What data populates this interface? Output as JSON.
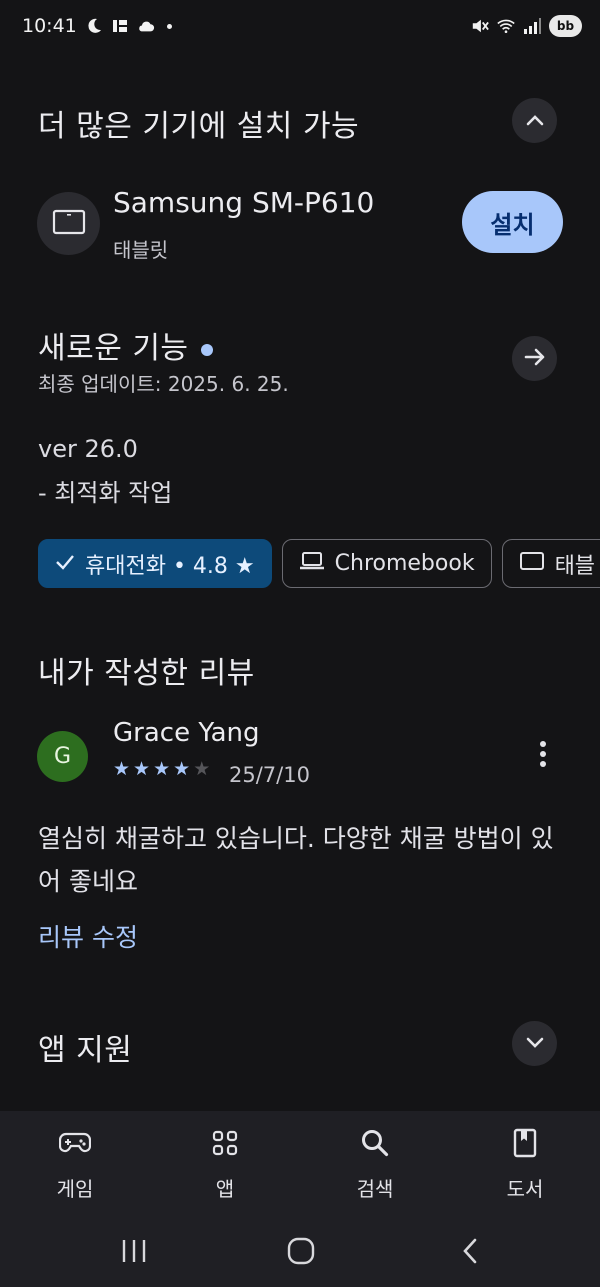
{
  "status_bar": {
    "time": "10:41",
    "battery": "bb"
  },
  "devices_section": {
    "title": "더 많은 기기에 설치 가능",
    "device_name": "Samsung SM-P610",
    "device_type": "태블릿",
    "install_label": "설치"
  },
  "whats_new": {
    "title": "새로운 기능",
    "updated": "최종 업데이트: 2025. 6. 25.",
    "notes": [
      "ver 26.0",
      "- 최적화 작업"
    ]
  },
  "filter_chips": [
    {
      "label": "휴대전화 • 4.8 ★",
      "selected": true,
      "icon": "check-icon"
    },
    {
      "label": "Chromebook",
      "selected": false,
      "icon": "laptop-icon"
    },
    {
      "label": "태블",
      "selected": false,
      "icon": "tablet-icon"
    }
  ],
  "my_review": {
    "title": "내가 작성한 리뷰",
    "avatar_letter": "G",
    "reviewer": "Grace Yang",
    "rating": 4,
    "rating_max": 5,
    "date": "25/7/10",
    "text": "열심히 채굴하고 있습니다. 다양한 채굴 방법이 있어 좋네요",
    "edit_label": "리뷰 수정"
  },
  "app_support": {
    "title": "앱 지원"
  },
  "bottom_nav": [
    {
      "label": "게임",
      "icon": "gamepad-icon"
    },
    {
      "label": "앱",
      "icon": "apps-grid-icon"
    },
    {
      "label": "검색",
      "icon": "search-icon"
    },
    {
      "label": "도서",
      "icon": "book-icon"
    }
  ],
  "colors": {
    "accent": "#a8c7fa",
    "background": "#141416",
    "selected_chip": "#0d4a7a"
  }
}
